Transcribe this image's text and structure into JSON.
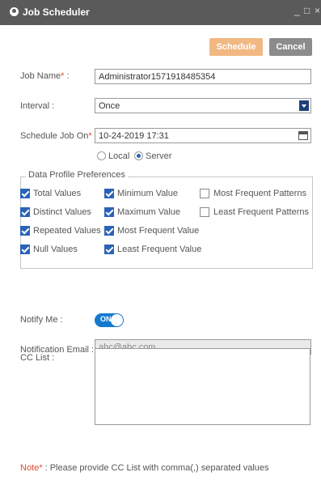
{
  "window": {
    "title": "Job Scheduler",
    "minimize": "_",
    "maximize": "□",
    "close": "×"
  },
  "toolbar": {
    "schedule_label": "Schedule",
    "cancel_label": "Cancel"
  },
  "form": {
    "job_name": {
      "label": "Job Name",
      "required_mark": "*",
      "suffix": " :",
      "value": "Administrator1571918485354"
    },
    "interval": {
      "label": "Interval :",
      "value": "Once"
    },
    "schedule_on": {
      "label": "Schedule Job On",
      "required_mark": "*",
      "suffix": " :",
      "value": "10-24-2019 17:31"
    },
    "time_zone": {
      "options": [
        "Local",
        "Server"
      ],
      "selected": "Server"
    },
    "notify": {
      "label": "Notify Me :",
      "toggle_text": "ON",
      "enabled": true
    },
    "email": {
      "label": "Notification Email :",
      "placeholder": "abc@abc.com"
    },
    "cc_list": {
      "label": "CC List :",
      "value": ""
    }
  },
  "preferences": {
    "legend": "Data Profile Preferences",
    "items": [
      {
        "label": "Total Values",
        "checked": true
      },
      {
        "label": "Minimum Value",
        "checked": true
      },
      {
        "label": "Most Frequent Patterns",
        "checked": false
      },
      {
        "label": "Distinct Values",
        "checked": true
      },
      {
        "label": "Maximum Value",
        "checked": true
      },
      {
        "label": "Least Frequent Patterns",
        "checked": false
      },
      {
        "label": "Repeated Values",
        "checked": true
      },
      {
        "label": "Most Frequent Value",
        "checked": true
      },
      {
        "label": "Null Values",
        "checked": true
      },
      {
        "label": "Least Frequent Value",
        "checked": true
      }
    ]
  },
  "note": {
    "prefix": "Note",
    "required_mark": "*",
    "text": " : Please provide CC List with comma(,) separated values"
  },
  "colors": {
    "titlebar": "#5a5a5a",
    "schedule_button": "#f1b883",
    "cancel_button": "#8c8c8c",
    "accent": "#2a63b8",
    "toggle": "#1479cf",
    "required": "#e24a2b"
  }
}
